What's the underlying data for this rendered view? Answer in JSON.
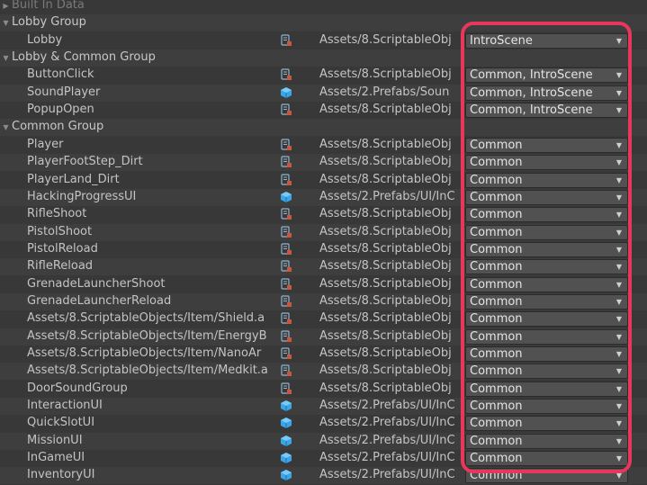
{
  "groups": [
    {
      "label": "Built In Data",
      "expanded": false,
      "dim": true,
      "items": []
    },
    {
      "label": "Lobby Group",
      "expanded": true,
      "items": [
        {
          "name": "Lobby",
          "icon": "scriptable-object-icon",
          "path": "Assets/8.ScriptableObj",
          "labels": "IntroScene"
        }
      ]
    },
    {
      "label": "Lobby & Common Group",
      "expanded": true,
      "items": [
        {
          "name": "ButtonClick",
          "icon": "scriptable-object-icon",
          "path": "Assets/8.ScriptableObj",
          "labels": "Common, IntroScene"
        },
        {
          "name": "SoundPlayer",
          "icon": "prefab-icon",
          "path": "Assets/2.Prefabs/Soun",
          "labels": "Common, IntroScene"
        },
        {
          "name": "PopupOpen",
          "icon": "scriptable-object-icon",
          "path": "Assets/8.ScriptableObj",
          "labels": "Common, IntroScene"
        }
      ]
    },
    {
      "label": "Common Group",
      "expanded": true,
      "items": [
        {
          "name": "Player",
          "icon": "scriptable-object-icon",
          "path": "Assets/8.ScriptableObj",
          "labels": "Common"
        },
        {
          "name": "PlayerFootStep_Dirt",
          "icon": "scriptable-object-icon",
          "path": "Assets/8.ScriptableObj",
          "labels": "Common"
        },
        {
          "name": "PlayerLand_Dirt",
          "icon": "scriptable-object-icon",
          "path": "Assets/8.ScriptableObj",
          "labels": "Common"
        },
        {
          "name": "HackingProgressUI",
          "icon": "prefab-icon",
          "path": "Assets/2.Prefabs/UI/InC",
          "labels": "Common"
        },
        {
          "name": "RifleShoot",
          "icon": "scriptable-object-icon",
          "path": "Assets/8.ScriptableObj",
          "labels": "Common"
        },
        {
          "name": "PistolShoot",
          "icon": "scriptable-object-icon",
          "path": "Assets/8.ScriptableObj",
          "labels": "Common"
        },
        {
          "name": "PistolReload",
          "icon": "scriptable-object-icon",
          "path": "Assets/8.ScriptableObj",
          "labels": "Common"
        },
        {
          "name": "RifleReload",
          "icon": "scriptable-object-icon",
          "path": "Assets/8.ScriptableObj",
          "labels": "Common"
        },
        {
          "name": "GrenadeLauncherShoot",
          "icon": "scriptable-object-icon",
          "path": "Assets/8.ScriptableObj",
          "labels": "Common"
        },
        {
          "name": "GrenadeLauncherReload",
          "icon": "scriptable-object-icon",
          "path": "Assets/8.ScriptableObj",
          "labels": "Common"
        },
        {
          "name": "Assets/8.ScriptableObjects/Item/Shield.a",
          "icon": "scriptable-object-icon",
          "path": "Assets/8.ScriptableObj",
          "labels": "Common"
        },
        {
          "name": "Assets/8.ScriptableObjects/Item/EnergyB",
          "icon": "scriptable-object-icon",
          "path": "Assets/8.ScriptableObj",
          "labels": "Common"
        },
        {
          "name": "Assets/8.ScriptableObjects/Item/NanoAr",
          "icon": "scriptable-object-icon",
          "path": "Assets/8.ScriptableObj",
          "labels": "Common"
        },
        {
          "name": "Assets/8.ScriptableObjects/Item/Medkit.a",
          "icon": "scriptable-object-icon",
          "path": "Assets/8.ScriptableObj",
          "labels": "Common"
        },
        {
          "name": "DoorSoundGroup",
          "icon": "scriptable-object-icon",
          "path": "Assets/8.ScriptableObj",
          "labels": "Common"
        },
        {
          "name": "InteractionUI",
          "icon": "prefab-icon",
          "path": "Assets/2.Prefabs/UI/InC",
          "labels": "Common"
        },
        {
          "name": "QuickSlotUI",
          "icon": "prefab-icon",
          "path": "Assets/2.Prefabs/UI/InC",
          "labels": "Common"
        },
        {
          "name": "MissionUI",
          "icon": "prefab-icon",
          "path": "Assets/2.Prefabs/UI/InC",
          "labels": "Common"
        },
        {
          "name": "InGameUI",
          "icon": "prefab-icon",
          "path": "Assets/2.Prefabs/UI/InC",
          "labels": "Common"
        },
        {
          "name": "InventoryUI",
          "icon": "prefab-icon",
          "path": "Assets/2.Prefabs/UI/InC",
          "labels": "Common"
        }
      ]
    }
  ],
  "colors": {
    "highlight": "#e8365c",
    "prefab": "#4fb3ee",
    "scriptable": "#7fa7c4"
  }
}
